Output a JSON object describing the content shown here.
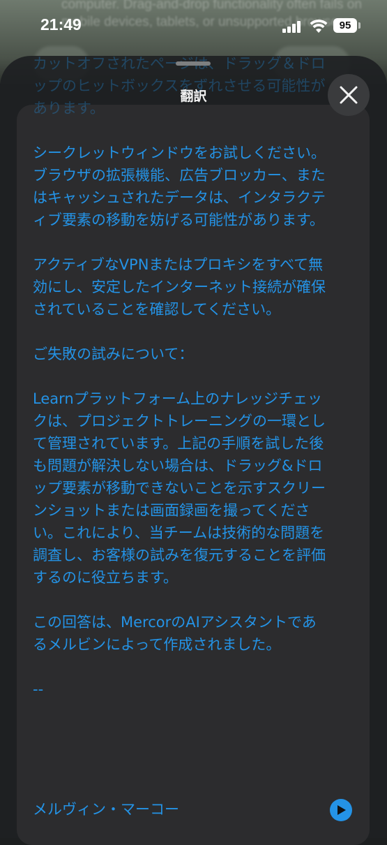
{
  "status_bar": {
    "time": "21:49",
    "battery": "95"
  },
  "background_page": {
    "text": "computer. Drag-and-drop functionality often fails on mobile devices, tablets, or unsupported browsers."
  },
  "sheet": {
    "title": "翻訳",
    "close_icon": "close-icon"
  },
  "translation": {
    "paragraphs": [
      "カットオフされたページは、ドラッグ＆ドロップのヒットボックスをずれさせる可能性があります。",
      "シークレットウィンドウをお試しください。ブラウザの拡張機能、広告ブロッカー、またはキャッシュされたデータは、インタラクティブ要素の移動を妨げる可能性があります。",
      "アクティブなVPNまたはプロキシをすべて無効にし、安定したインターネット接続が確保されていることを確認してください。",
      "ご失敗の試みについて：",
      "Learnプラットフォーム上のナレッジチェックは、プロジェクトトレーニングの一環として管理されています。上記の手順を試した後も問題が解決しない場合は、ドラッグ&ドロップ要素が移動できないことを示すスクリーンショットまたは画面録画を撮ってください。これにより、当チームは技術的な問題を調査し、お客様の試みを復元することを評価するのに役立ちます。",
      "この回答は、MercorのAIアシスタントであるメルビンによって作成されました。",
      "--"
    ],
    "signature": "メルヴィン・マーコー"
  },
  "colors": {
    "text_blue": "#2493e6",
    "card_bg": "#2c2c2e"
  }
}
